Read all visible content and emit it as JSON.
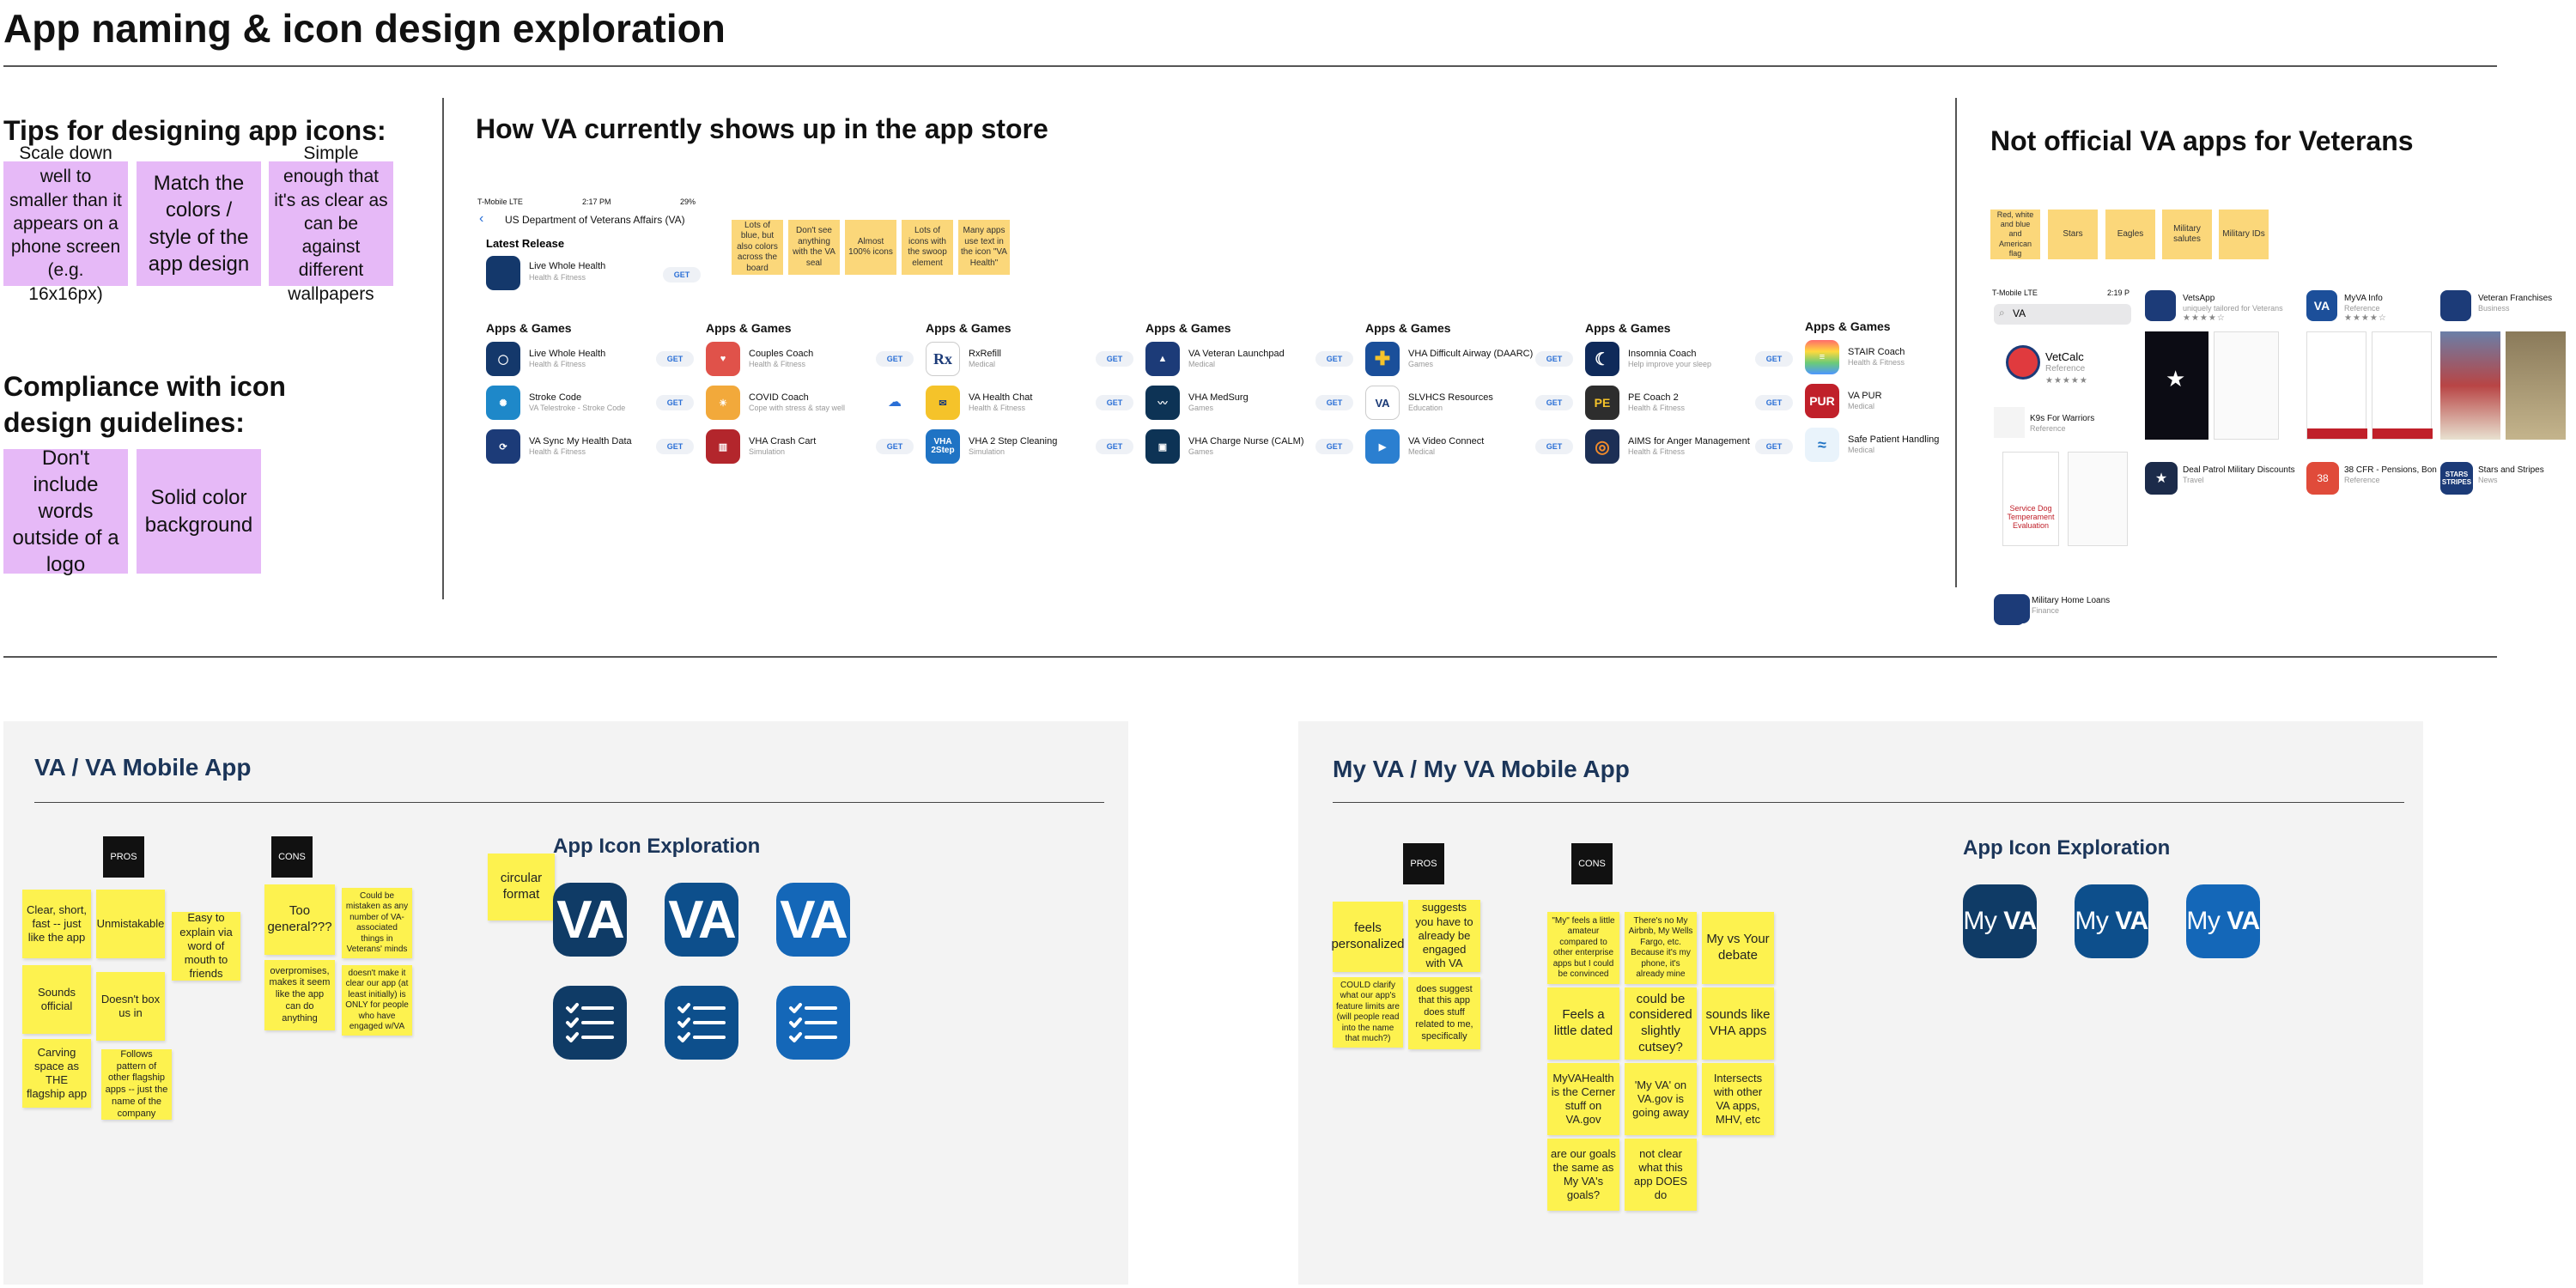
{
  "title": "App naming & icon design exploration",
  "tips": {
    "heading": "Tips for designing app icons:",
    "cards": [
      "Scale down well to smaller than it appears on a phone screen (e.g. 16x16px)",
      "Match the colors / style of the app design",
      "Simple enough that it's as clear as can be against different wallpapers"
    ]
  },
  "compliance": {
    "heading": "Compliance with icon design guidelines:",
    "cards": [
      "Don't include words outside of a logo",
      "Solid color background"
    ]
  },
  "store": {
    "heading": "How VA currently shows up in the app store",
    "status": {
      "carrier": "T-Mobile  LTE",
      "time": "2:17 PM",
      "battery": "29%"
    },
    "dev_title": "US Department of Veterans Affairs (VA)",
    "latest_release": "Latest Release",
    "latest": {
      "name": "Live Whole Health",
      "sub": "Health & Fitness"
    },
    "get": "GET",
    "apps_games": "Apps & Games",
    "notes": [
      "Lots of blue, but also colors across the board",
      "Don't see anything with the VA seal",
      "Almost 100% icons",
      "Lots of icons with the swoop element",
      "Many apps use text in the icon \"VA Health\""
    ],
    "columns": [
      [
        {
          "name": "Live Whole Health",
          "sub": "Health & Fitness"
        },
        {
          "name": "Stroke Code",
          "sub": "VA Telestroke - Stroke Code"
        },
        {
          "name": "VA Sync My Health Data",
          "sub": "Health & Fitness"
        }
      ],
      [
        {
          "name": "Couples Coach",
          "sub": "Health & Fitness"
        },
        {
          "name": "COVID Coach",
          "sub": "Cope with stress & stay well"
        },
        {
          "name": "VHA Crash Cart",
          "sub": "Simulation"
        }
      ],
      [
        {
          "name": "RxRefill",
          "sub": "Medical"
        },
        {
          "name": "VA Health Chat",
          "sub": "Health & Fitness"
        },
        {
          "name": "VHA 2 Step Cleaning",
          "sub": "Simulation"
        }
      ],
      [
        {
          "name": "VA Veteran Launchpad",
          "sub": "Medical"
        },
        {
          "name": "VHA MedSurg",
          "sub": "Games"
        },
        {
          "name": "VHA Charge Nurse (CALM)",
          "sub": "Games"
        }
      ],
      [
        {
          "name": "VHA Difficult Airway (DAARC)",
          "sub": "Games"
        },
        {
          "name": "SLVHCS Resources",
          "sub": "Education"
        },
        {
          "name": "VA Video Connect",
          "sub": "Medical"
        }
      ],
      [
        {
          "name": "Insomnia Coach",
          "sub": "Help improve your sleep"
        },
        {
          "name": "PE Coach 2",
          "sub": "Health & Fitness"
        },
        {
          "name": "AIMS for Anger Management",
          "sub": "Health & Fitness"
        }
      ],
      [
        {
          "name": "STAIR Coach",
          "sub": "Health & Fitness"
        },
        {
          "name": "VA PUR",
          "sub": "Medical"
        },
        {
          "name": "Safe Patient Handling",
          "sub": "Medical"
        }
      ]
    ],
    "icon_text": {
      "rx": "Rx",
      "vha": "VHA 2Step",
      "va": "VA",
      "pe": "PE",
      "pur": "PUR"
    }
  },
  "unofficial": {
    "heading": "Not official VA apps for Veterans",
    "notes": [
      "Red, white and blue and American flag",
      "Stars",
      "Eagles",
      "Military salutes",
      "Military IDs"
    ],
    "search": {
      "carrier": "T-Mobile  LTE",
      "time": "2:19 P",
      "query": "VA"
    },
    "apps": [
      {
        "name": "VetCalc",
        "sub": "Reference"
      },
      {
        "name": "K9s For Warriors",
        "sub": "Reference"
      },
      {
        "name": "Military Home Loans",
        "sub": "Finance"
      },
      {
        "name": "VetsApp",
        "sub": "uniquely tailored for Veterans"
      },
      {
        "name": "Deal Patrol Military Discounts",
        "sub": "Travel"
      },
      {
        "name": "MyVA Info",
        "sub": "Reference"
      },
      {
        "name": "38 CFR - Pensions, Bon",
        "sub": "Reference"
      },
      {
        "name": "Veteran Franchises",
        "sub": "Business"
      },
      {
        "name": "Stars and Stripes",
        "sub": "News"
      }
    ],
    "service_dog": "Service Dog Temperament Evaluation",
    "stars_icon": "STARS STRIPES"
  },
  "va_panel": {
    "title": "VA / VA Mobile App",
    "pros_label": "PROS",
    "cons_label": "CONS",
    "pros": [
      "Clear, short, fast -- just like the app",
      "Unmistakable",
      "Easy to explain via word of mouth  to friends",
      "Sounds official",
      "Doesn't box us in",
      "Carving space as THE flagship app",
      "Follows pattern of other flagship apps -- just the name of the company"
    ],
    "cons": [
      "Too general???",
      "Could be mistaken as any number of VA-associated things in Veterans' minds",
      "overpromises, makes it seem like the app can do anything",
      "doesn't make it clear our app (at least initially) is ONLY for people who have engaged w/VA"
    ],
    "circular_note": "circular format",
    "exploration_title": "App Icon Exploration",
    "icon_label": "VA",
    "colors": [
      "#0f3b66",
      "#0d4f8c",
      "#1467b8"
    ]
  },
  "myva_panel": {
    "title": "My VA / My VA Mobile App",
    "pros_label": "PROS",
    "cons_label": "CONS",
    "pros": [
      "feels personalized",
      "suggests you have to already be engaged with VA",
      "COULD clarify what our app's feature limits are (will people read into the name that much?)",
      "does suggest that this app does stuff related to me, specifically"
    ],
    "cons": [
      "\"My\" feels a little amateur compared to other enterprise apps but I could be convinced",
      "There's no My Airbnb, My Wells Fargo, etc. Because it's my phone, it's already mine",
      "My vs Your debate",
      "Feels a little dated",
      "could be considered slightly cutsey?",
      "sounds like VHA apps",
      "MyVAHealth is the Cerner stuff on VA.gov",
      "'My VA' on VA.gov is going away",
      "Intersects with other VA apps, MHV, etc",
      "are our goals the same as My VA's goals?",
      "not clear what this app DOES do"
    ],
    "exploration_title": "App Icon Exploration",
    "icon_my": "My",
    "icon_va": "VA",
    "colors": [
      "#0f3b66",
      "#0d4f8c",
      "#1467b8"
    ]
  }
}
